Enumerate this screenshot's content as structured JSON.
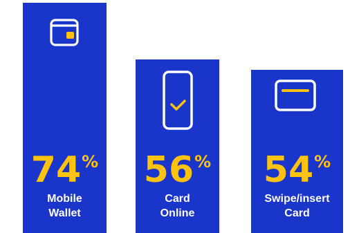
{
  "chart_data": {
    "type": "bar",
    "categories": [
      "Mobile Wallet",
      "Card Online",
      "Swipe/insert Card"
    ],
    "values": [
      74,
      56,
      54
    ],
    "category_lines": [
      [
        "Mobile",
        "Wallet"
      ],
      [
        "Card",
        "Online"
      ],
      [
        "Swipe/insert",
        "Card"
      ]
    ],
    "value_suffix": "%",
    "icons": [
      "wallet-icon",
      "smartphone-check-icon",
      "credit-card-icon"
    ],
    "colors": {
      "bar": "#1a35c9",
      "value": "#ffc20e",
      "label": "#ffffff",
      "icon": "#ffffff"
    }
  }
}
